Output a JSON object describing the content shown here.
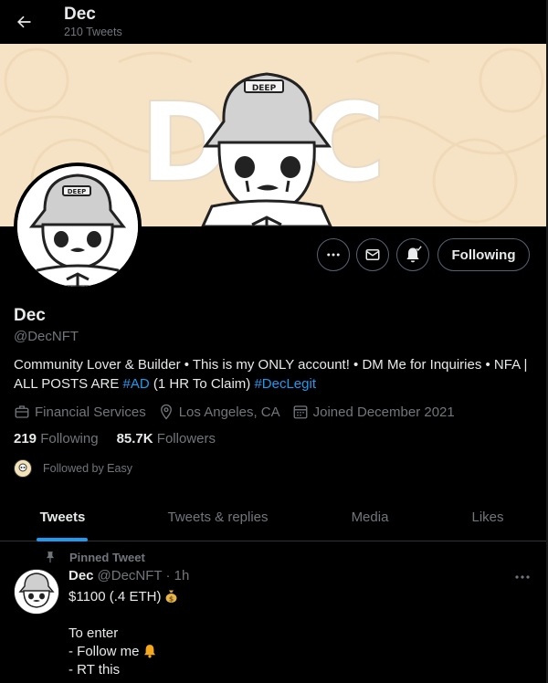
{
  "header": {
    "title": "Dec",
    "tweet_count": "210 Tweets"
  },
  "banner": {
    "text": "DEC",
    "hat_text": "DEEP"
  },
  "profile": {
    "name": "Dec",
    "handle": "@DecNFT",
    "bio_part1": "Community Lover & Builder • This is my ONLY account! • DM Me for Inquiries • NFA | ALL POSTS ARE ",
    "bio_tag1": "#AD",
    "bio_part2": " (1 HR To Claim) ",
    "bio_tag2": "#DecLegit",
    "category": "Financial Services",
    "location": "Los Angeles, CA",
    "joined": "Joined December 2021",
    "following_count": "219",
    "following_label": "Following",
    "followers_count": "85.7K",
    "followers_label": "Followers",
    "followed_by": "Followed by Easy"
  },
  "actions": {
    "more_icon": "more-icon",
    "message_icon": "mail-icon",
    "notify_icon": "bell-icon",
    "following_label": "Following"
  },
  "tabs": [
    {
      "label": "Tweets",
      "active": true
    },
    {
      "label": "Tweets & replies",
      "active": false
    },
    {
      "label": "Media",
      "active": false
    },
    {
      "label": "Likes",
      "active": false
    }
  ],
  "tweet": {
    "pinned_label": "Pinned Tweet",
    "author_name": "Dec",
    "author_handle": "@DecNFT · 1h",
    "line1": "$1100 (.4 ETH)",
    "line2": "To enter",
    "line3": "- Follow me",
    "line4": "- RT this"
  },
  "colors": {
    "accent": "#1d9bf0",
    "muted": "#71767b",
    "banner": "#f6e3c6"
  }
}
